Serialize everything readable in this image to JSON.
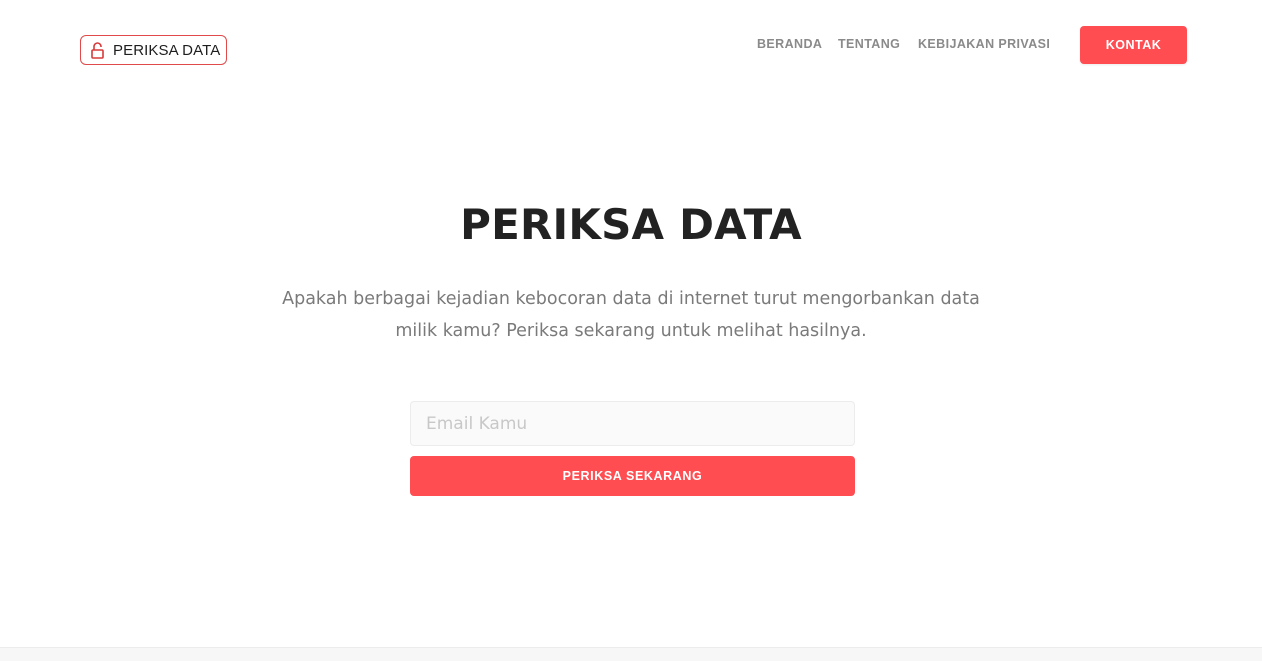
{
  "header": {
    "logo_text": "PERIKSA DATA",
    "logo_icon": "unlocked-padlock-icon",
    "nav": [
      {
        "label": "BERANDA"
      },
      {
        "label": "TENTANG"
      },
      {
        "label": "KEBIJAKAN PRIVASI"
      }
    ],
    "contact_label": "KONTAK"
  },
  "hero": {
    "title": "PERIKSA DATA",
    "description_line1": "Apakah berbagai kejadian kebocoran data di internet turut mengorbankan data",
    "description_line2": "milik kamu? Periksa sekarang untuk melihat hasilnya."
  },
  "form": {
    "email_placeholder": "Email Kamu",
    "email_value": "",
    "submit_label": "PERIKSA SEKARANG"
  },
  "colors": {
    "accent": "#ff4d52",
    "logo_border": "#e04a4a",
    "title": "#222222",
    "muted_text": "#7a7a7a",
    "nav_text": "#8a8a8a"
  }
}
